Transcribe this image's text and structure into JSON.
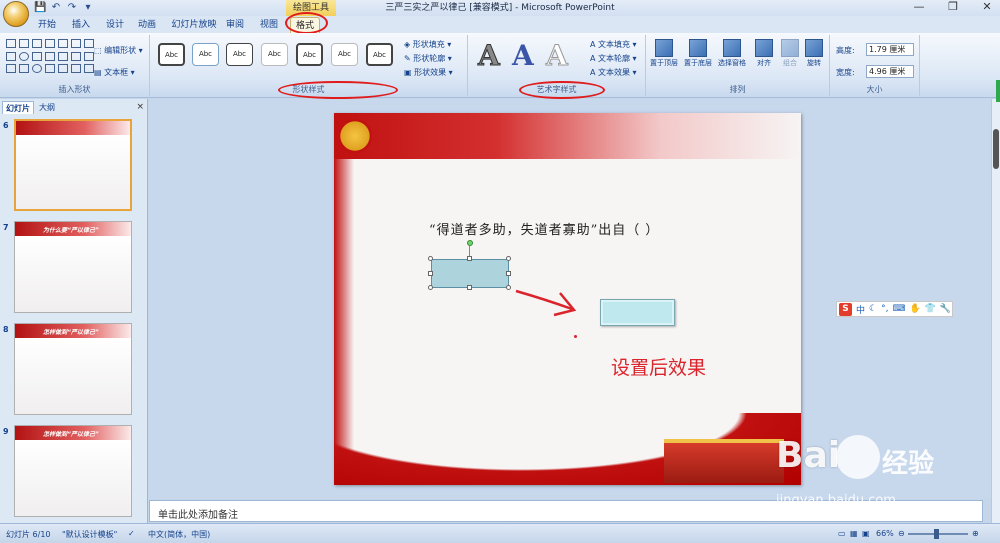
{
  "window": {
    "title": "三严三实之严以律己 [兼容模式] - Microsoft PowerPoint",
    "contextual_tab_group": "绘图工具",
    "controls": [
      "—",
      "❐",
      "✕"
    ]
  },
  "qat": [
    "💾",
    "↶",
    "↷",
    "▾"
  ],
  "tabs": [
    {
      "label": "开始",
      "active": false
    },
    {
      "label": "插入",
      "active": false
    },
    {
      "label": "设计",
      "active": false
    },
    {
      "label": "动画",
      "active": false
    },
    {
      "label": "幻灯片放映",
      "active": false
    },
    {
      "label": "审阅",
      "active": false
    },
    {
      "label": "视图",
      "active": false
    },
    {
      "label": "格式",
      "active": true
    }
  ],
  "ribbon": {
    "insert_shapes": {
      "label": "插入形状",
      "edit_shape": "编辑形状",
      "text_box": "文本框"
    },
    "shape_styles": {
      "label": "形状样式",
      "style_sample": "Abc",
      "shape_fill": "形状填充",
      "shape_outline": "形状轮廓",
      "shape_effects": "形状效果"
    },
    "wordart_styles": {
      "label": "艺术字样式",
      "sample": "A",
      "text_fill": "文本填充",
      "text_outline": "文本轮廓",
      "text_effects": "文本效果"
    },
    "arrange": {
      "label": "排列",
      "bring_to_front": "置于顶层",
      "send_to_back": "置于底层",
      "selection_pane": "选择窗格",
      "align": "对齐",
      "group": "组合",
      "rotate": "旋转"
    },
    "size": {
      "label": "大小",
      "height_label": "高度:",
      "height_value": "1.79 厘米",
      "width_label": "宽度:",
      "width_value": "4.96 厘米"
    }
  },
  "slide_pane": {
    "tabs": [
      "幻灯片",
      "大纲"
    ],
    "close": "×",
    "thumbnails": [
      {
        "num": "6",
        "title": "",
        "selected": true
      },
      {
        "num": "7",
        "title": "为什么要“严以律己”",
        "selected": false
      },
      {
        "num": "8",
        "title": "怎样做到“严以律己”",
        "selected": false
      },
      {
        "num": "9",
        "title": "怎样做到“严以律己”",
        "selected": false
      }
    ]
  },
  "slide": {
    "question": "“得道者多助，失道者寡助”出自（    ）",
    "result_label": "设置后效果"
  },
  "notes": {
    "placeholder": "单击此处添加备注"
  },
  "ime": {
    "logo": "S",
    "lang": "中"
  },
  "status": {
    "slide_info": "幻灯片 6/10",
    "theme": "\"默认设计模板\"",
    "language": "中文(简体，中国)",
    "zoom": "66%"
  },
  "watermark": {
    "logo": "Bai",
    "brand": "经验",
    "url": "jingyan.baidu.com"
  },
  "colors": {
    "accent_red": "#e01b1b",
    "ribbon_bg": "#dce7f5",
    "slide_red": "#c01010"
  }
}
